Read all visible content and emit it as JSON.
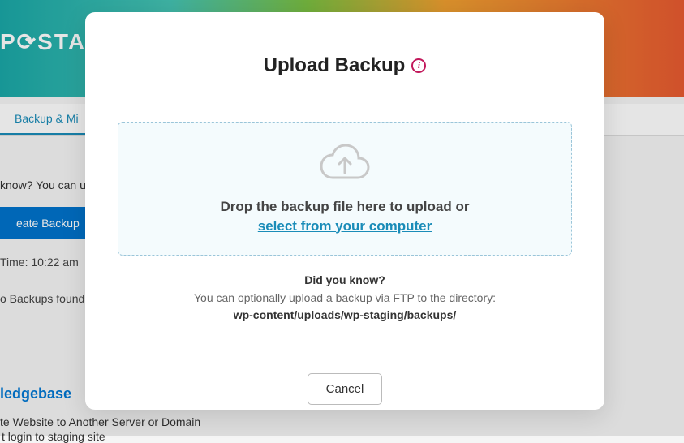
{
  "background": {
    "logo": "P⟳STA",
    "tab": "Backup & Mi",
    "knowText": "know? You can u",
    "createBtn": "eate Backup",
    "timeText": "Time: 10:22 am",
    "noBackups": "o Backups found.",
    "kbHeading": "ledgebase",
    "link1": "te Website to Another Server or Domain",
    "link2": "t login to staging site"
  },
  "modal": {
    "title": "Upload Backup",
    "dropText": "Drop the backup file here to upload or",
    "selectLink": "select from your computer",
    "hintTitle": "Did you know?",
    "hintBody": "You can optionally upload a backup via FTP to the directory:",
    "hintPath": "wp-content/uploads/wp-staging/backups/",
    "cancelBtn": "Cancel"
  }
}
